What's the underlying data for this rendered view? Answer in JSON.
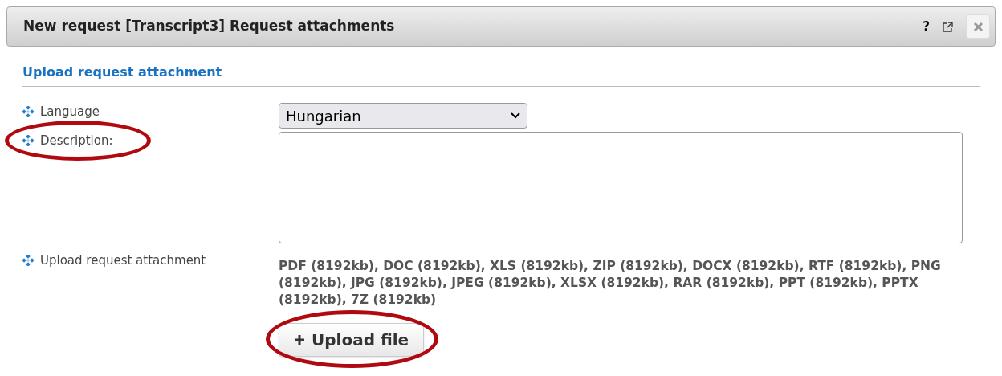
{
  "window": {
    "title": "New request [Transcript3] Request attachments",
    "help_label": "?"
  },
  "section": {
    "title": "Upload request attachment"
  },
  "fields": [
    {
      "kind": "select",
      "label": "Language",
      "value": "Hungarian",
      "highlighted": false
    },
    {
      "kind": "textarea",
      "label": "Description:",
      "highlighted": true
    },
    {
      "kind": "upload",
      "label": "Upload request attachment",
      "note": "PDF (8192kb), DOC (8192kb), XLS (8192kb), ZIP (8192kb), DOCX (8192kb), RTF (8192kb), PNG (8192kb), JPG (8192kb), JPEG (8192kb), XLSX (8192kb), RAR (8192kb), PPT (8192kb), PPTX (8192kb), 7Z (8192kb)",
      "button": {
        "label": "Upload file",
        "highlighted": true
      },
      "highlighted": false
    }
  ]
}
